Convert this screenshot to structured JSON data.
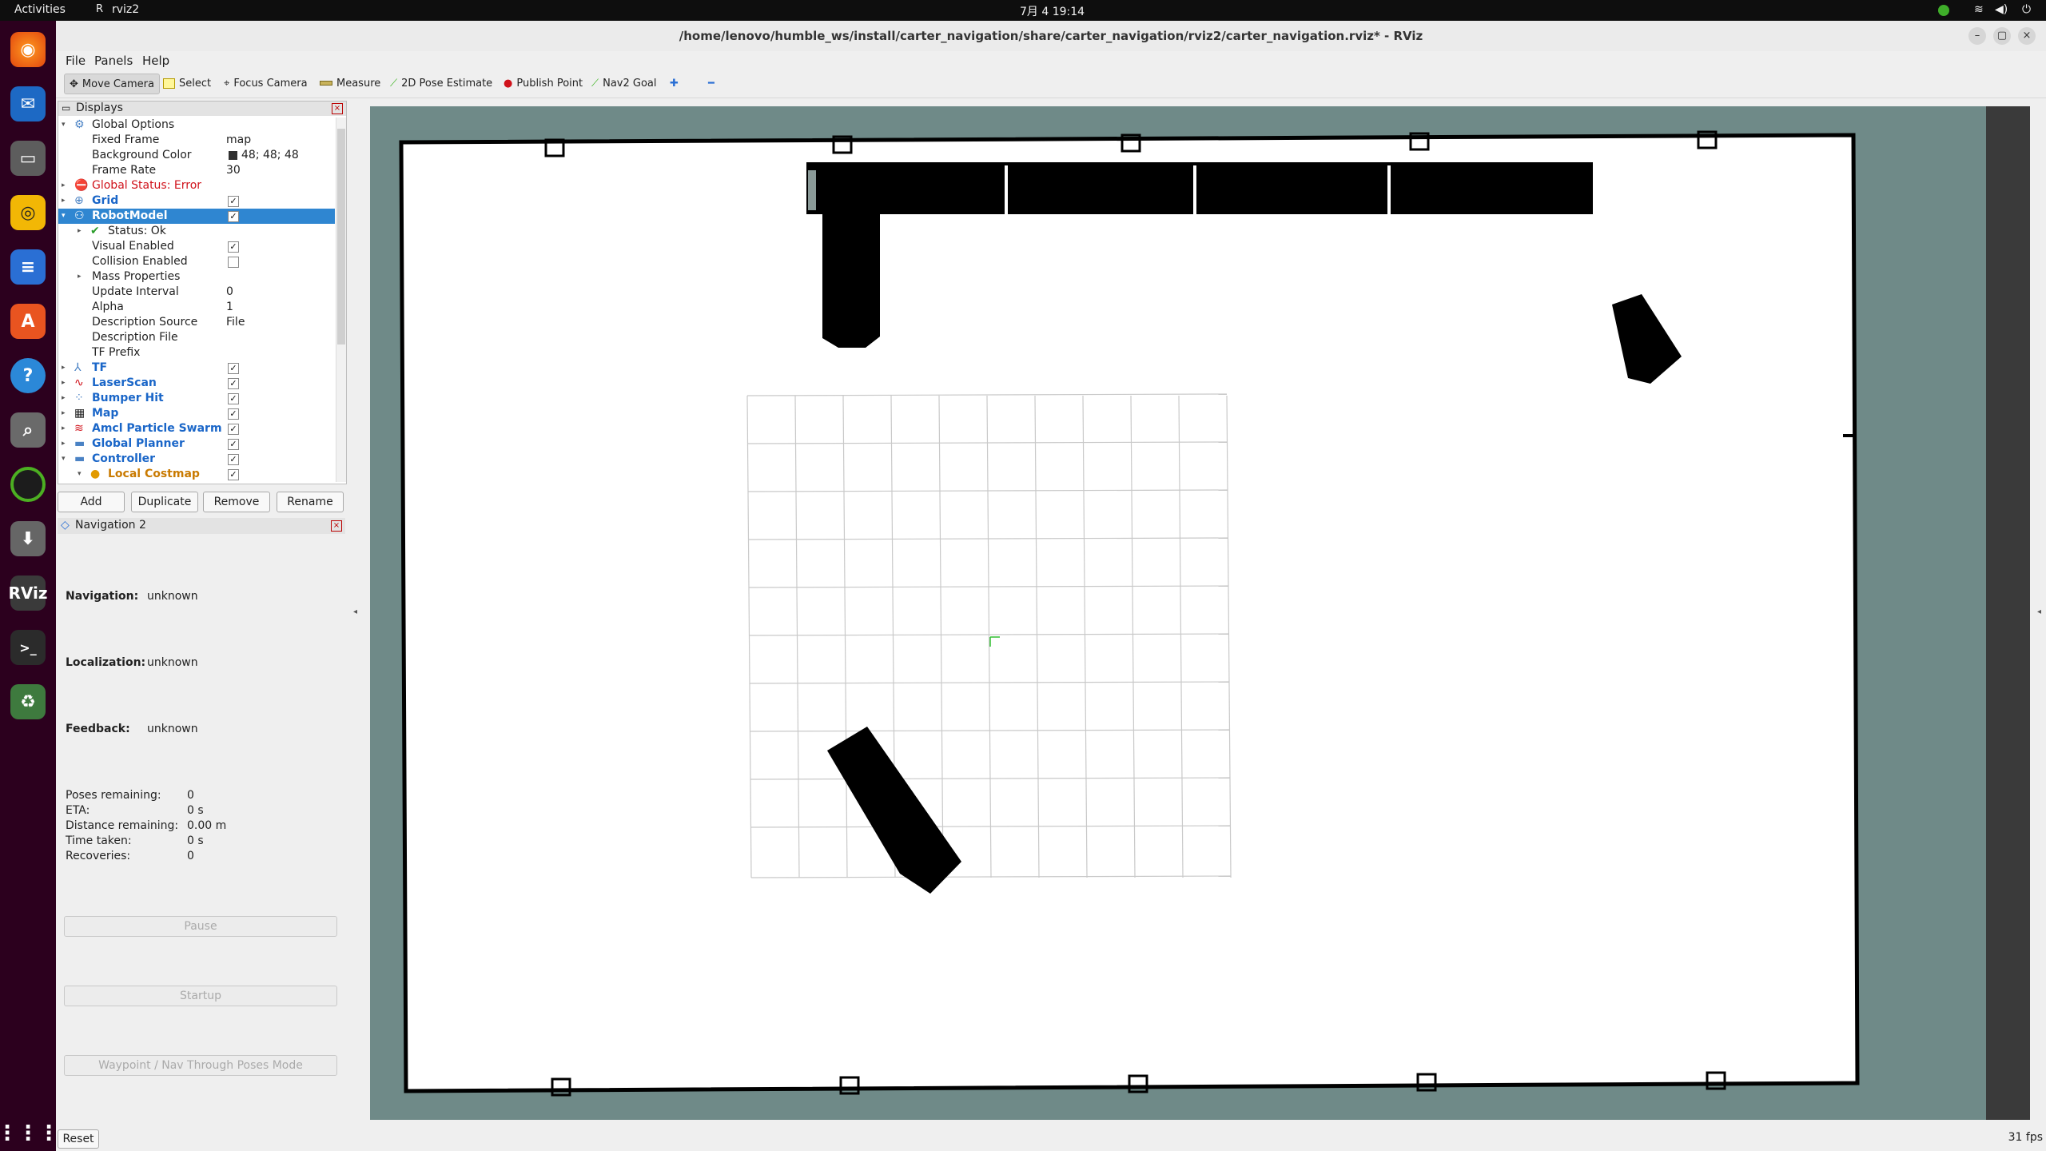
{
  "topbar": {
    "activities": "Activities",
    "app": "rviz2",
    "clock": "7月 4  19:14"
  },
  "window": {
    "title": "/home/lenovo/humble_ws/install/carter_navigation/share/carter_navigation/rviz2/carter_navigation.rviz* - RViz"
  },
  "menu": {
    "file": "File",
    "panels": "Panels",
    "help": "Help"
  },
  "toolbar": {
    "move_camera": "Move Camera",
    "select": "Select",
    "focus_camera": "Focus Camera",
    "measure": "Measure",
    "pose_estimate": "2D Pose Estimate",
    "publish_point": "Publish Point",
    "nav2_goal": "Nav2 Goal"
  },
  "displays": {
    "title": "Displays",
    "global_options": "Global Options",
    "fixed_frame_label": "Fixed Frame",
    "fixed_frame_value": "map",
    "bg_color_label": "Background Color",
    "bg_color_value": "48; 48; 48",
    "frame_rate_label": "Frame Rate",
    "frame_rate_value": "30",
    "global_status": "Global Status: Error",
    "grid": "Grid",
    "robot_model": "RobotModel",
    "status_ok": "Status: Ok",
    "visual_enabled": "Visual Enabled",
    "collision_enabled": "Collision Enabled",
    "mass_properties": "Mass Properties",
    "update_interval_label": "Update Interval",
    "update_interval_value": "0",
    "alpha_label": "Alpha",
    "alpha_value": "1",
    "desc_source_label": "Description Source",
    "desc_source_value": "File",
    "desc_file_label": "Description File",
    "tf_prefix_label": "TF Prefix",
    "tf": "TF",
    "laser_scan": "LaserScan",
    "bumper_hit": "Bumper Hit",
    "map": "Map",
    "amcl": "Amcl Particle Swarm",
    "global_planner": "Global Planner",
    "controller": "Controller",
    "local_costmap": "Local Costmap",
    "buttons": {
      "add": "Add",
      "duplicate": "Duplicate",
      "remove": "Remove",
      "rename": "Rename"
    }
  },
  "nav2": {
    "title": "Navigation 2",
    "navigation_label": "Navigation:",
    "navigation_value": "unknown",
    "localization_label": "Localization:",
    "localization_value": "unknown",
    "feedback_label": "Feedback:",
    "feedback_value": "unknown",
    "poses_label": "Poses remaining:",
    "poses_value": "0",
    "eta_label": "ETA:",
    "eta_value": "0 s",
    "distance_label": "Distance remaining:",
    "distance_value": "0.00 m",
    "time_label": "Time taken:",
    "time_value": "0 s",
    "recoveries_label": "Recoveries:",
    "recoveries_value": "0",
    "pause": "Pause",
    "startup": "Startup",
    "waypoint_mode": "Waypoint / Nav Through Poses Mode"
  },
  "status": {
    "reset": "Reset",
    "fps": "31 fps"
  },
  "colors": {
    "selection": "#2f86d1",
    "view_bg": "#6f8a88",
    "dock": "#2c001e"
  }
}
